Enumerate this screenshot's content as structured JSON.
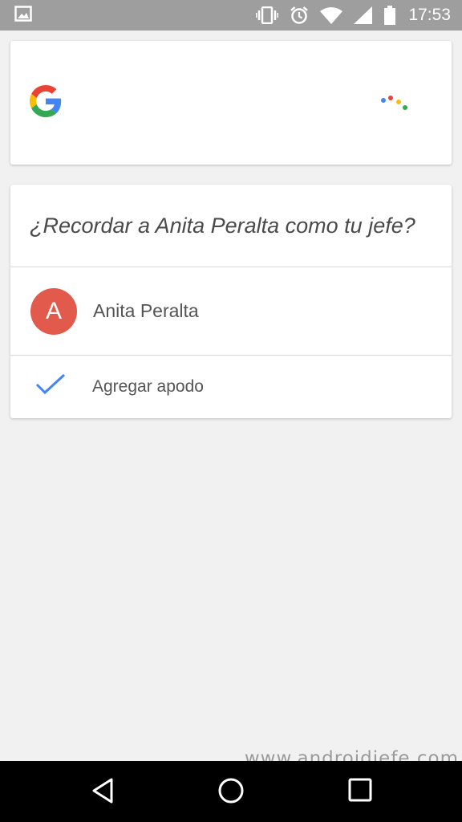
{
  "status_bar": {
    "time": "17:53",
    "icons": [
      "image-notification-icon",
      "vibrate-icon",
      "alarm-icon",
      "wifi-icon",
      "signal-icon",
      "battery-icon"
    ]
  },
  "assistant": {
    "logo": "google-g-icon",
    "indicator": "assistant-dots-icon",
    "colors": {
      "blue": "#4285F4",
      "red": "#EA4335",
      "yellow": "#FBBC05",
      "green": "#34A853"
    }
  },
  "prompt": {
    "question": "¿Recordar a Anita Peralta como tu jefe?",
    "contact": {
      "initial": "A",
      "name": "Anita Peralta",
      "avatar_color": "#E25A4B"
    },
    "action": {
      "label": "Agregar apodo",
      "icon": "check-icon",
      "icon_color": "#4285F4"
    }
  },
  "watermark": "www.androidjefe.com",
  "nav_bar": {
    "buttons": [
      "back-icon",
      "home-icon",
      "recents-icon"
    ]
  }
}
